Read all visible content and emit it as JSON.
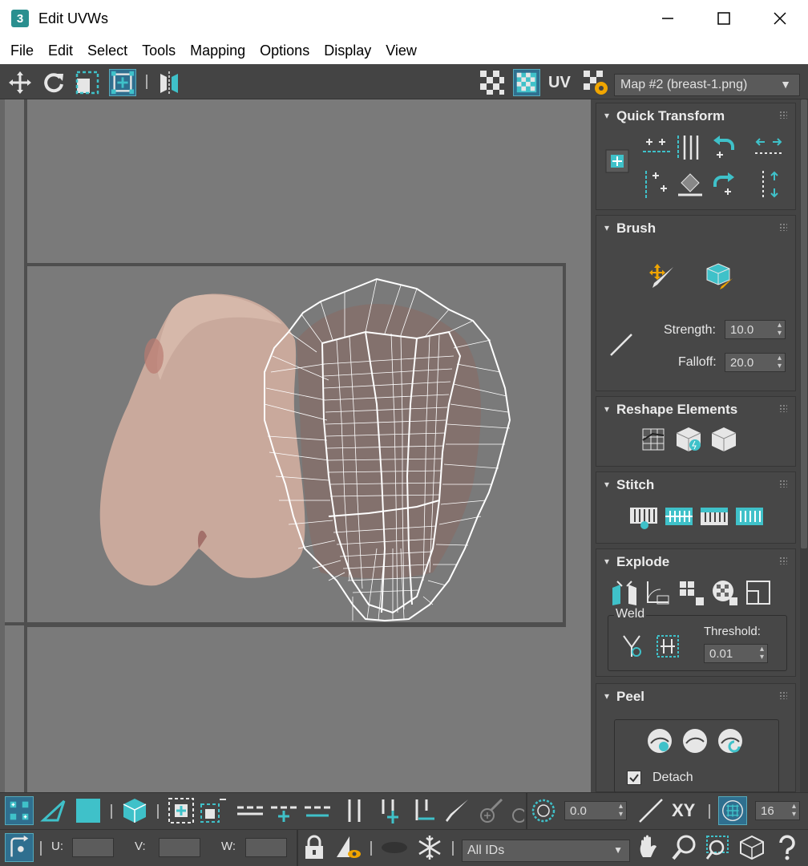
{
  "window": {
    "title": "Edit UVWs",
    "app_icon_label": "3",
    "minimize": "—",
    "maximize": "☐",
    "close": "✕"
  },
  "menu": [
    "File",
    "Edit",
    "Select",
    "Tools",
    "Mapping",
    "Options",
    "Display",
    "View"
  ],
  "toolbar": {
    "uv_label": "UV",
    "map_select": "Map #2 (breast-1.png)",
    "map_arrow": "▼"
  },
  "panel": {
    "quick_transform": {
      "title": "Quick Transform"
    },
    "brush": {
      "title": "Brush",
      "strength_label": "Strength:",
      "strength_value": "10.0",
      "falloff_label": "Falloff:",
      "falloff_value": "20.0"
    },
    "reshape": {
      "title": "Reshape Elements"
    },
    "stitch": {
      "title": "Stitch"
    },
    "explode": {
      "title": "Explode",
      "weld_label": "Weld",
      "threshold_label": "Threshold:",
      "threshold_value": "0.01"
    },
    "peel": {
      "title": "Peel",
      "detach_label": "Detach",
      "detach_checked": true
    }
  },
  "bottom": {
    "angle_value": "0.0",
    "xy_label": "XY",
    "grid_value": "16",
    "u_label": "U:",
    "v_label": "V:",
    "w_label": "W:",
    "ids_select": "All IDs"
  },
  "colors": {
    "accent": "#3fc1c9",
    "bg_dark": "#444444",
    "viewport": "#7a7a7a"
  }
}
